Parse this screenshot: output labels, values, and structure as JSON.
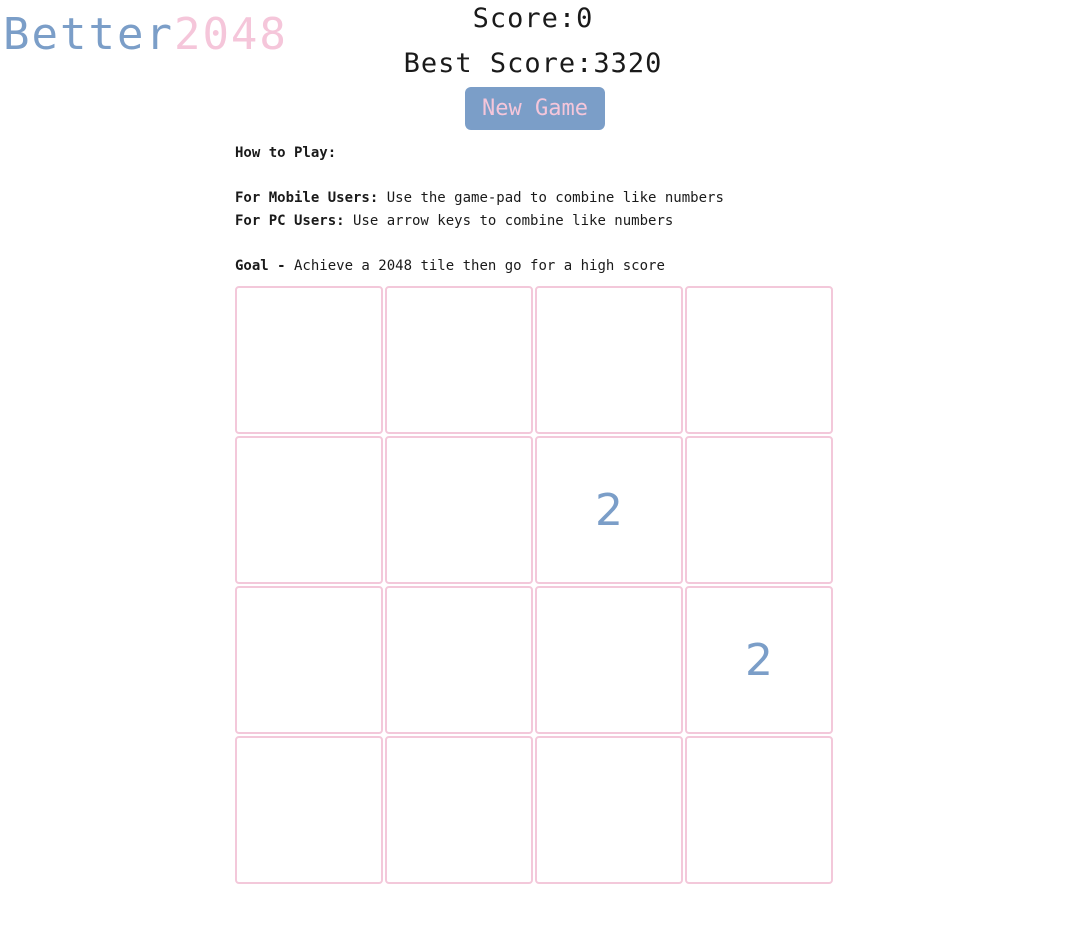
{
  "logo": {
    "part1": "Better",
    "part2": "2048"
  },
  "colors": {
    "blue": "#7b9ec8",
    "pink": "#f5c6da",
    "text": "#1a1a1a"
  },
  "score": {
    "label": "Score:",
    "value": "0"
  },
  "best_score": {
    "label": "Best Score:",
    "value": "3320"
  },
  "new_game_label": "New Game",
  "instructions": {
    "heading": "How to Play:",
    "mobile_label": "For Mobile Users:",
    "mobile_text": " Use the game-pad to combine like numbers",
    "pc_label": "For PC Users:",
    "pc_text": " Use arrow keys to combine like numbers",
    "goal_label": "Goal -",
    "goal_text": " Achieve a 2048 tile then go for a high score"
  },
  "board": [
    [
      "",
      "",
      "",
      ""
    ],
    [
      "",
      "",
      "2",
      ""
    ],
    [
      "",
      "",
      "",
      "2"
    ],
    [
      "",
      "",
      "",
      ""
    ]
  ]
}
